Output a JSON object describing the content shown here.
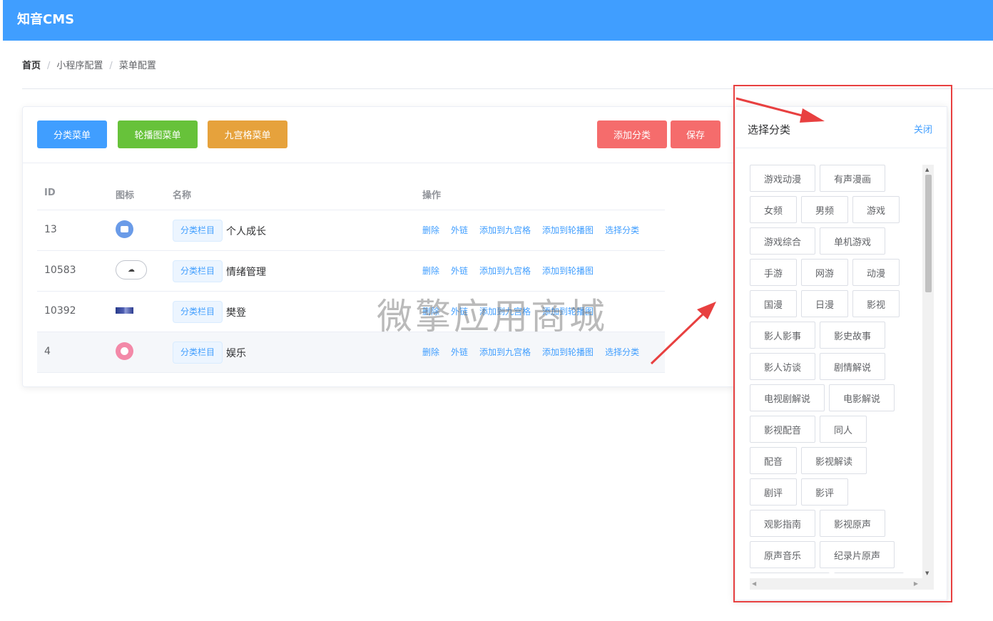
{
  "app": {
    "logo": "知音CMS"
  },
  "breadcrumb": {
    "home": "首页",
    "level2": "小程序配置",
    "level3": "菜单配置",
    "separator": "/"
  },
  "toolbar": {
    "category_menu": "分类菜单",
    "carousel_menu": "轮播图菜单",
    "grid_menu": "九宫格菜单",
    "add_category": "添加分类",
    "save": "保存"
  },
  "table": {
    "headers": {
      "id": "ID",
      "icon": "图标",
      "name": "名称",
      "ops": "操作"
    },
    "rows": [
      {
        "id": "13",
        "icon": "blue-square-icon",
        "tag": "分类栏目",
        "name": "个人成长",
        "ops": [
          "删除",
          "外链",
          "添加到九宫格",
          "添加到轮播图",
          "选择分类"
        ]
      },
      {
        "id": "10583",
        "icon": "cloud-icon",
        "tag": "分类栏目",
        "name": "情绪管理",
        "ops": [
          "删除",
          "外链",
          "添加到九宫格",
          "添加到轮播图"
        ]
      },
      {
        "id": "10392",
        "icon": "banner-image-icon",
        "tag": "分类栏目",
        "name": "樊登",
        "ops": [
          "删除",
          "外链",
          "添加到九宫格",
          "添加到轮播图"
        ]
      },
      {
        "id": "4",
        "icon": "pink-circle-icon",
        "tag": "分类栏目",
        "name": "娱乐",
        "ops": [
          "删除",
          "外链",
          "添加到九宫格",
          "添加到轮播图",
          "选择分类"
        ]
      }
    ]
  },
  "watermark": "微擎应用商城",
  "panel": {
    "title": "选择分类",
    "close": "关闭",
    "rows": [
      [
        "游戏动漫",
        "有声漫画"
      ],
      [
        "女频",
        "男频",
        "游戏"
      ],
      [
        "游戏综合",
        "单机游戏"
      ],
      [
        "手游",
        "网游",
        "动漫"
      ],
      [
        "国漫",
        "日漫",
        "影视"
      ],
      [
        "影人影事",
        "影史故事"
      ],
      [
        "影人访谈",
        "剧情解说"
      ],
      [
        "电视剧解说",
        "电影解说"
      ],
      [
        "影视配音",
        "同人"
      ],
      [
        "配音",
        "影视解读"
      ],
      [
        "剧评",
        "影评"
      ],
      [
        "观影指南",
        "影视原声"
      ],
      [
        "原声音乐",
        "纪录片原声"
      ],
      [
        "",
        ""
      ]
    ]
  },
  "colors": {
    "primary": "#409eff",
    "success": "#67c23a",
    "warning": "#e6a23c",
    "danger": "#f56c6c",
    "annotation": "#e84040"
  }
}
